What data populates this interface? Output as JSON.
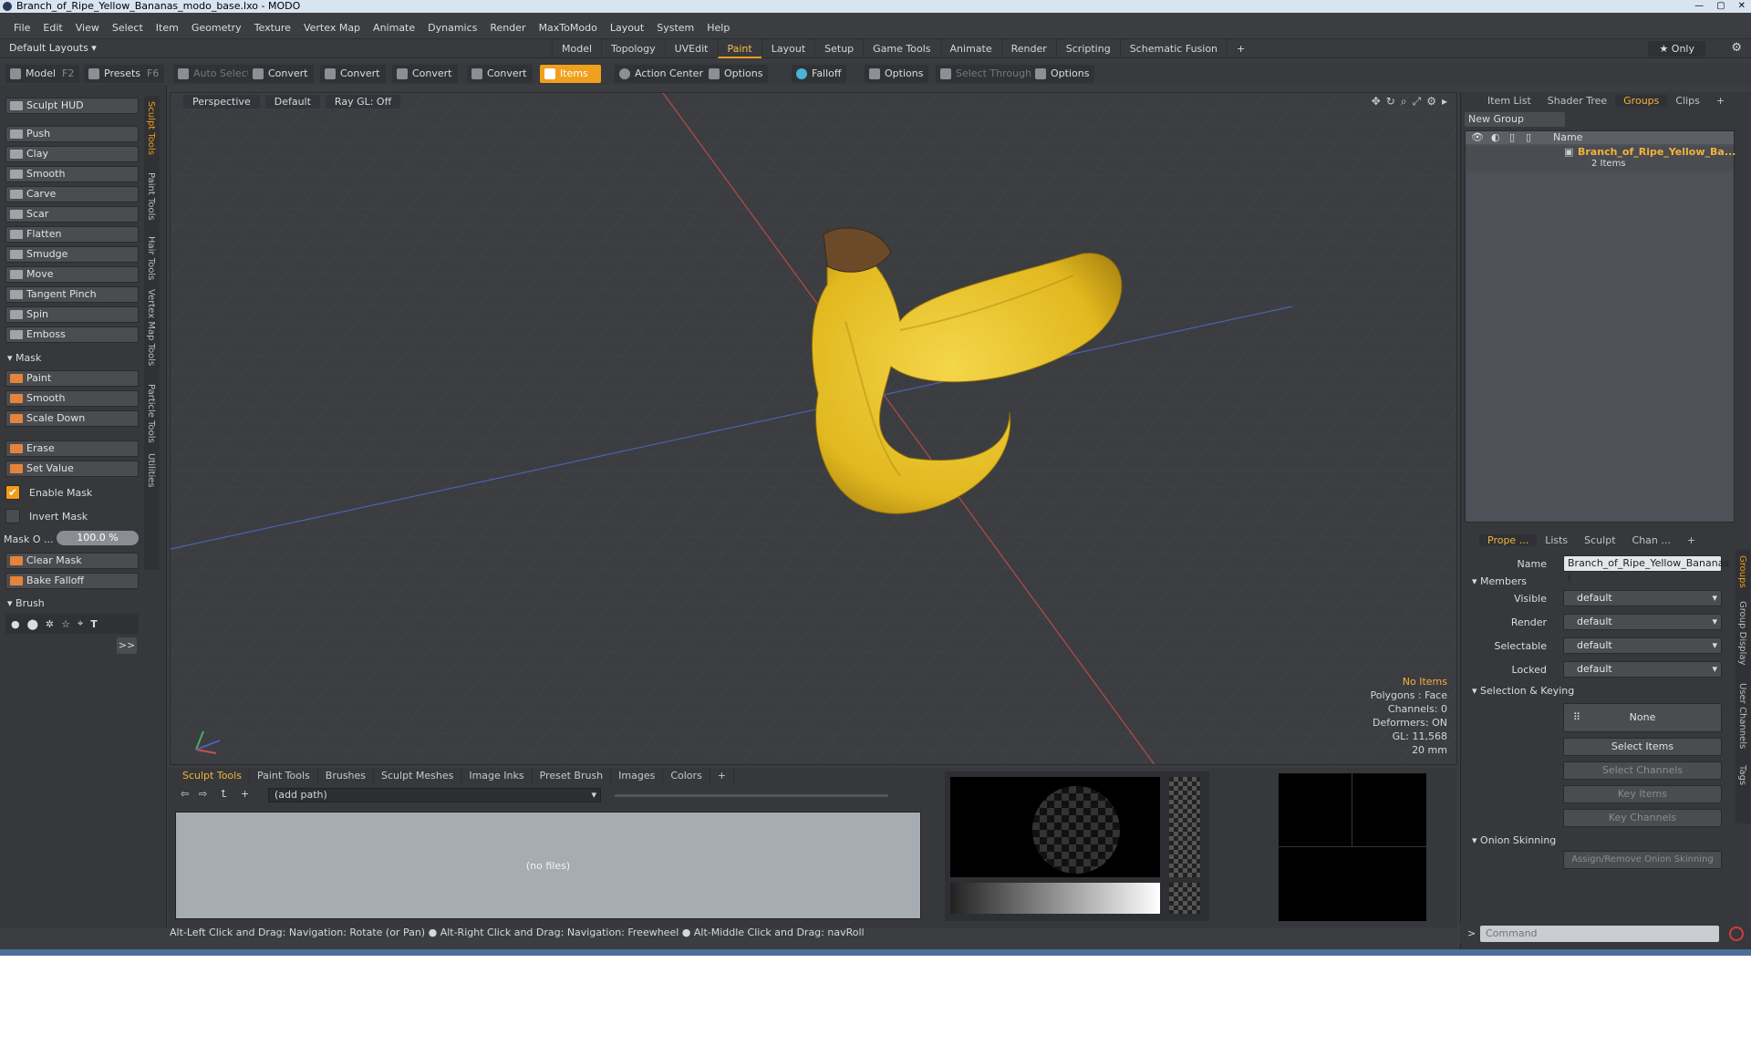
{
  "window": {
    "title": "Branch_of_Ripe_Yellow_Bananas_modo_base.lxo - MODO"
  },
  "menu": [
    "File",
    "Edit",
    "View",
    "Select",
    "Item",
    "Geometry",
    "Texture",
    "Vertex Map",
    "Animate",
    "Dynamics",
    "Render",
    "MaxToModo",
    "Layout",
    "System",
    "Help"
  ],
  "layoutbar": {
    "default_layouts": "Default Layouts ▾",
    "tabs": [
      "Model",
      "Topology",
      "UVEdit",
      "Paint",
      "Layout",
      "Setup",
      "Game Tools",
      "Animate",
      "Render",
      "Scripting",
      "Schematic Fusion",
      "+"
    ],
    "active_tab": "Paint",
    "only": "★  Only"
  },
  "toolbar": {
    "model": "Model",
    "model_key": "F2",
    "presets": "Presets",
    "presets_key": "F6",
    "auto_select": "Auto Select",
    "convert1": "Convert",
    "convert2": "Convert",
    "convert3": "Convert",
    "convert4": "Convert",
    "items": "Items",
    "action_center": "Action Center",
    "options1": "Options",
    "falloff": "Falloff",
    "options2": "Options",
    "select_through": "Select Through",
    "options3": "Options"
  },
  "leftpanel": {
    "sculpt_hud": "Sculpt HUD",
    "tools": [
      "Push",
      "Clay",
      "Smooth",
      "Carve",
      "Scar",
      "Flatten",
      "Smudge",
      "Move",
      "Tangent Pinch",
      "Spin",
      "Emboss"
    ],
    "mask_header": "Mask",
    "mask_tools": [
      "Paint",
      "Smooth",
      "Scale Down"
    ],
    "erase": "Erase",
    "set_value": "Set Value",
    "enable_mask": "Enable Mask",
    "invert_mask": "Invert Mask",
    "mask_opacity_label": "Mask O ...",
    "mask_opacity_value": "100.0 %",
    "clear_mask": "Clear Mask",
    "bake_falloff": "Bake Falloff",
    "brush_header": "Brush",
    "vtabs": [
      "Sculpt Tools",
      "Paint Tools",
      "Hair Tools",
      "Vertex Map Tools",
      "Particle Tools",
      "Utilities"
    ]
  },
  "viewport": {
    "view": "Perspective",
    "shading": "Default",
    "raygl": "Ray GL: Off",
    "info": {
      "no_items": "No Items",
      "polygons": "Polygons : Face",
      "channels": "Channels: 0",
      "deformers": "Deformers: ON",
      "gl": "GL: 11,568",
      "scale": "20 mm"
    }
  },
  "bottompanel": {
    "tabs": [
      "Sculpt Tools",
      "Paint Tools",
      "Brushes",
      "Sculpt Meshes",
      "Image Inks",
      "Preset Brush",
      "Images",
      "Colors",
      "+"
    ],
    "path": "(add path)",
    "files": "(no files)"
  },
  "rightpanel": {
    "tabs": [
      "Item List",
      "Shader Tree",
      "Groups",
      "Clips",
      "+"
    ],
    "active_tab": "Groups",
    "new_group": "New Group",
    "list_header": "Name",
    "group_name": "Branch_of_Ripe_Yellow_Ba...",
    "group_sub": "2 Items"
  },
  "props": {
    "tabs": [
      "Prope ...",
      "Lists",
      "Sculpt",
      "Chan ...",
      "+"
    ],
    "name_label": "Name",
    "name_value": "Branch_of_Ripe_Yellow_Bananas (",
    "members": "Members",
    "visible_label": "Visible",
    "visible": "default",
    "render_label": "Render",
    "render": "default",
    "selectable_label": "Selectable",
    "selectable": "default",
    "locked_label": "Locked",
    "locked": "default",
    "selection_keying": "Selection & Keying",
    "none": "None",
    "select_items": "Select Items",
    "select_channels": "Select Channels",
    "key_items": "Key Items",
    "key_channels": "Key Channels",
    "onion": "Onion Skinning",
    "assign_onion": "Assign/Remove Onion Skinning",
    "side_tabs": [
      "Groups",
      "Group Display",
      "User Channels",
      "Tags"
    ]
  },
  "command": {
    "placeholder": "Command",
    "prompt": ">"
  },
  "statusbar": "Alt-Left Click and Drag: Navigation: Rotate (or Pan) ● Alt-Right Click and Drag: Navigation: Freewheel ● Alt-Middle Click and Drag: navRoll",
  "colors": {
    "accent": "#f29d1a",
    "banana": "#e8c22c",
    "stem": "#6b4a2a"
  }
}
